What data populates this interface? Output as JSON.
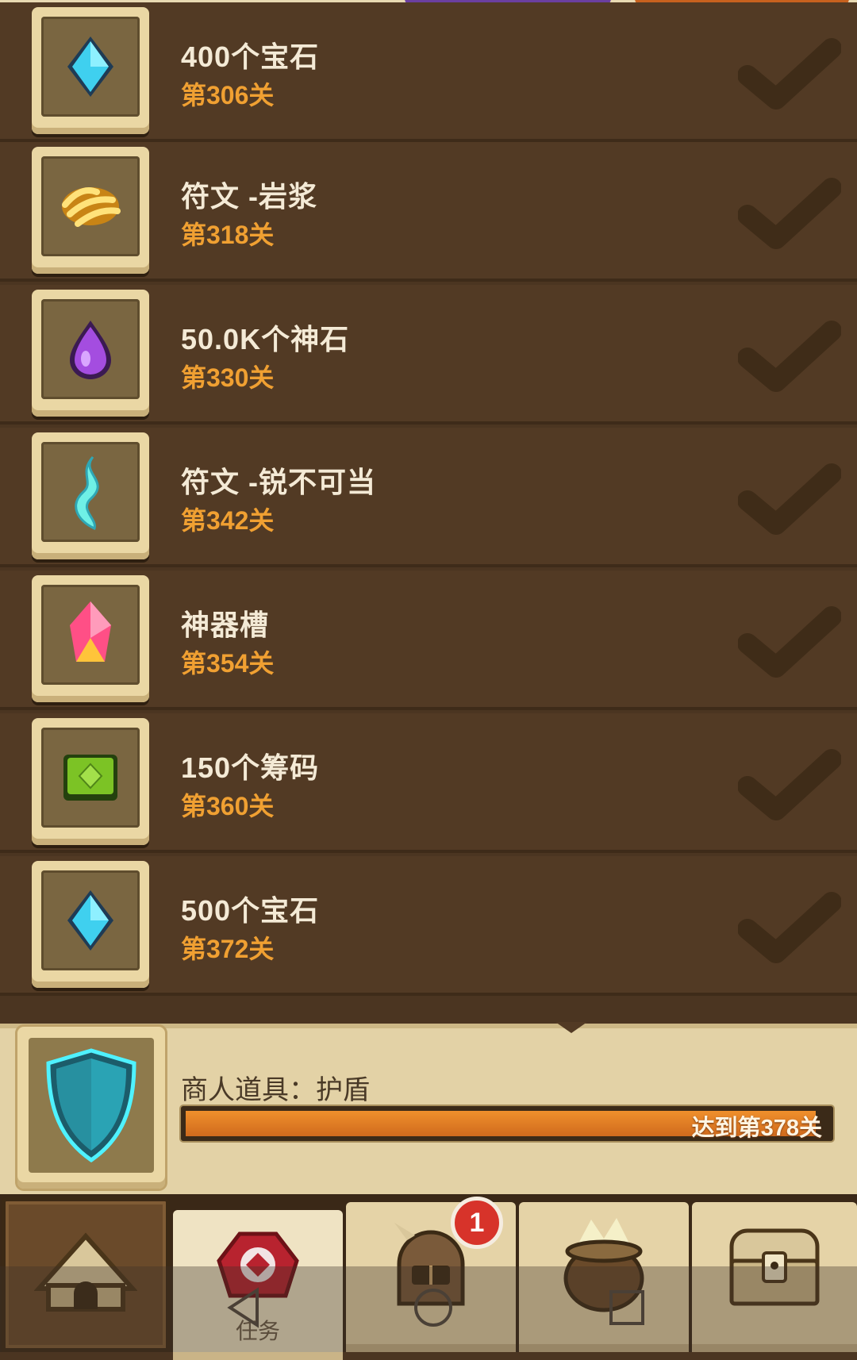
{
  "rewards": [
    {
      "icon": "blue-gem-icon",
      "title": "400个宝石",
      "level": "第306关"
    },
    {
      "icon": "lava-rune-icon",
      "title": "符文 -岩浆",
      "level": "第318关"
    },
    {
      "icon": "purple-stone-icon",
      "title": "50.0K个神石",
      "level": "第330关"
    },
    {
      "icon": "sharp-rune-icon",
      "title": "符文 -锐不可当",
      "level": "第342关"
    },
    {
      "icon": "artifact-crystal-icon",
      "title": "神器槽",
      "level": "第354关"
    },
    {
      "icon": "green-chip-icon",
      "title": "150个筹码",
      "level": "第360关"
    },
    {
      "icon": "blue-gem-icon",
      "title": "500个宝石",
      "level": "第372关"
    }
  ],
  "next_reward": {
    "icon": "shield-icon",
    "label": "商人道具：护盾",
    "progress_text": "达到第378关",
    "progress_fraction": 0.98
  },
  "tabs": [
    {
      "name": "home",
      "icon": "camp-tent-icon",
      "label": ""
    },
    {
      "name": "quests",
      "icon": "quest-scroll-icon",
      "label": "任务"
    },
    {
      "name": "heroes",
      "icon": "knight-helmet-icon",
      "label": ""
    },
    {
      "name": "alchemy",
      "icon": "cauldron-icon",
      "label": ""
    },
    {
      "name": "chest",
      "icon": "treasure-chest-icon",
      "label": ""
    }
  ],
  "badge_count": "1",
  "colors": {
    "row_bg": "#523a24",
    "title_text": "#f4ead6",
    "level_text": "#f0a032",
    "progress_fill": "#e07a22",
    "panel_bg": "#e3d2a6"
  }
}
